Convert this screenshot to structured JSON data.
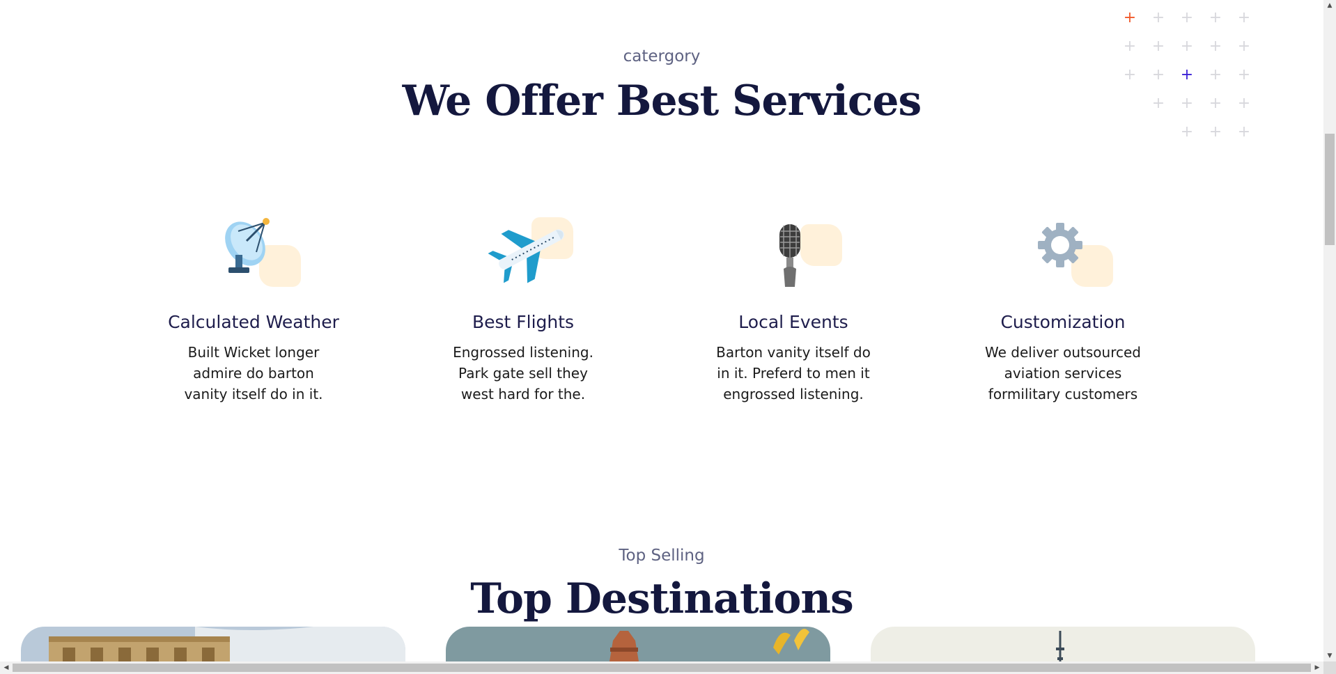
{
  "services_section": {
    "subtitle": "catergory",
    "title": "We Offer Best Services",
    "items": [
      {
        "icon": "satellite-dish-icon",
        "title": "Calculated Weather",
        "description": "Built Wicket longer admire do barton vanity itself do in it."
      },
      {
        "icon": "airplane-icon",
        "title": "Best Flights",
        "description": "Engrossed listening. Park gate sell they west hard for the."
      },
      {
        "icon": "microphone-icon",
        "title": "Local Events",
        "description": "Barton vanity itself do in it. Preferd to men it engrossed listening."
      },
      {
        "icon": "gear-icon",
        "title": "Customization",
        "description": "We deliver outsourced aviation services formilitary customers"
      }
    ]
  },
  "destinations_section": {
    "subtitle": "Top Selling",
    "title": "Top Destinations"
  },
  "colors": {
    "title": "#14183e",
    "subtitle": "#5e6282",
    "icon_blob": "#fff1da",
    "plus_accent_orange": "#f15a2b",
    "plus_accent_purple": "#3a20d6",
    "plus_default": "#d8d8dd"
  }
}
